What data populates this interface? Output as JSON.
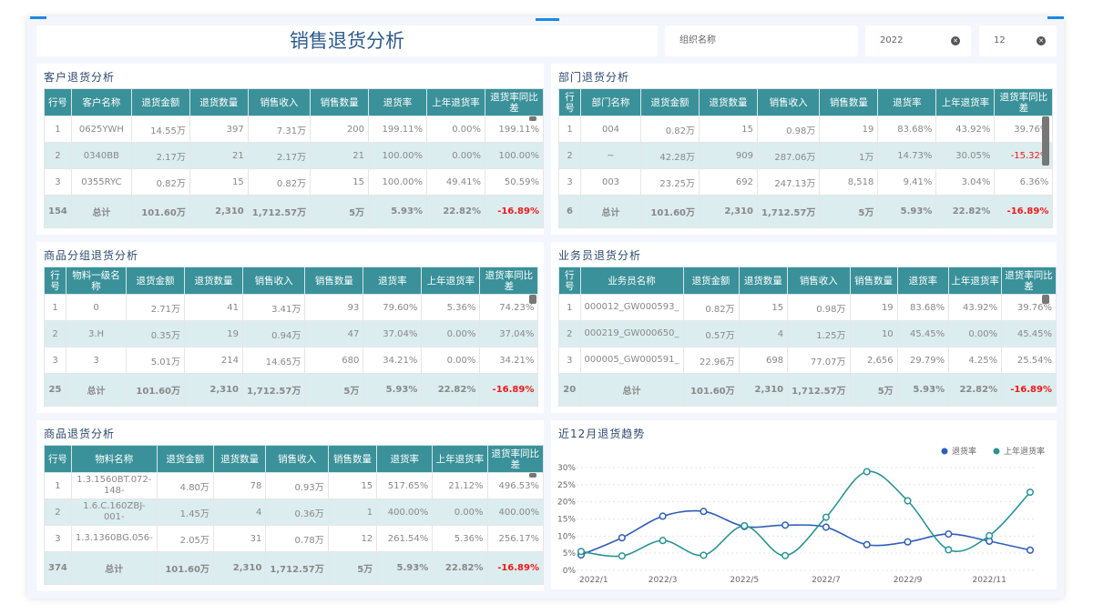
{
  "header": {
    "title": "销售退货分析",
    "org_placeholder": "组织名称",
    "year": "2022",
    "month": "12",
    "clear_icon": "x-circle-icon"
  },
  "columns_common": [
    "退货金额",
    "退货数量",
    "销售收入",
    "销售数量",
    "退货率",
    "上年退货率",
    "退货率同比差"
  ],
  "tables": [
    {
      "title": "客户退货分析",
      "col0": "行号",
      "col1": "客户名称",
      "rows": [
        [
          "1",
          "0625YWH",
          "14.55万",
          "397",
          "7.31万",
          "200",
          "199.11%",
          "0.00%",
          "199.11%"
        ],
        [
          "2",
          "0340BB",
          "2.17万",
          "21",
          "2.17万",
          "21",
          "100.00%",
          "0.00%",
          "100.00%"
        ],
        [
          "3",
          "0355RYC",
          "0.82万",
          "15",
          "0.82万",
          "15",
          "100.00%",
          "49.41%",
          "50.59%"
        ]
      ],
      "total": [
        "154",
        "总计",
        "101.60万",
        "2,310",
        "1,712.57万",
        "5万",
        "5.93%",
        "22.82%",
        "-16.89%"
      ]
    },
    {
      "title": "部门退货分析",
      "col0": "行号",
      "col1": "部门名称",
      "rows": [
        [
          "1",
          "004",
          "0.82万",
          "15",
          "0.98万",
          "19",
          "83.68%",
          "43.92%",
          "39.76%"
        ],
        [
          "2",
          "~",
          "42.28万",
          "909",
          "287.06万",
          "1万",
          "14.73%",
          "30.05%",
          "-15.32%"
        ],
        [
          "3",
          "003",
          "23.25万",
          "692",
          "247.13万",
          "8,518",
          "9.41%",
          "3.04%",
          "6.36%"
        ]
      ],
      "total": [
        "6",
        "总计",
        "101.60万",
        "2,310",
        "1,712.57万",
        "5万",
        "5.93%",
        "22.82%",
        "-16.89%"
      ]
    },
    {
      "title": "商品分组退货分析",
      "col0": "行号",
      "col1": "物料一级名称",
      "rows": [
        [
          "1",
          "0",
          "2.71万",
          "41",
          "3.41万",
          "93",
          "79.60%",
          "5.36%",
          "74.23%"
        ],
        [
          "2",
          "3.H",
          "0.35万",
          "19",
          "0.94万",
          "47",
          "37.04%",
          "0.00%",
          "37.04%"
        ],
        [
          "3",
          "3",
          "5.01万",
          "214",
          "14.65万",
          "680",
          "34.21%",
          "0.00%",
          "34.21%"
        ]
      ],
      "total": [
        "25",
        "总计",
        "101.60万",
        "2,310",
        "1,712.57万",
        "5万",
        "5.93%",
        "22.82%",
        "-16.89%"
      ]
    },
    {
      "title": "业务员退货分析",
      "col0": "行号",
      "col1": "业务员名称",
      "rows": [
        [
          "1",
          "000012_GW000593_",
          "0.82万",
          "15",
          "0.98万",
          "19",
          "83.68%",
          "43.92%",
          "39.76%"
        ],
        [
          "2",
          "000219_GW000650_",
          "0.57万",
          "4",
          "1.25万",
          "10",
          "45.45%",
          "0.00%",
          "45.45%"
        ],
        [
          "3",
          "000005_GW000591_",
          "22.96万",
          "698",
          "77.07万",
          "2,656",
          "29.79%",
          "4.25%",
          "25.54%"
        ]
      ],
      "total": [
        "20",
        "总计",
        "101.60万",
        "2,310",
        "1,712.57万",
        "5万",
        "5.93%",
        "22.82%",
        "-16.89%"
      ]
    },
    {
      "title": "商品退货分析",
      "col0": "行号",
      "col1": "物料名称",
      "rows": [
        [
          "1",
          "1.3.1560BT.072-148-",
          "4.80万",
          "78",
          "0.93万",
          "15",
          "517.65%",
          "21.12%",
          "496.53%"
        ],
        [
          "2",
          "1.6.C.160ZBJ-001-",
          "1.45万",
          "4",
          "0.36万",
          "1",
          "400.00%",
          "0.00%",
          "400.00%"
        ],
        [
          "3",
          "1.3.1360BG.056-",
          "2.05万",
          "31",
          "0.78万",
          "12",
          "261.54%",
          "5.36%",
          "256.17%"
        ]
      ],
      "total": [
        "374",
        "总计",
        "101.60万",
        "2,310",
        "1,712.57万",
        "5万",
        "5.93%",
        "22.82%",
        "-16.89%"
      ]
    }
  ],
  "chart_data": {
    "type": "line",
    "title": "近12月退货趋势",
    "x": [
      "2022/1",
      "2022/2",
      "2022/3",
      "2022/4",
      "2022/5",
      "2022/6",
      "2022/7",
      "2022/8",
      "2022/9",
      "2022/10",
      "2022/11",
      "2022/12"
    ],
    "xticks": [
      "2022/1",
      "2022/3",
      "2022/5",
      "2022/7",
      "2022/9",
      "2022/11"
    ],
    "yticks": [
      "0%",
      "5%",
      "10%",
      "15%",
      "20%",
      "25%",
      "30%"
    ],
    "ylim": [
      0,
      30
    ],
    "series": [
      {
        "name": "退货率",
        "color": "#2f5fb8",
        "values": [
          4.5,
          9.5,
          15.8,
          17.2,
          12.8,
          13.2,
          12.6,
          7.5,
          8.3,
          10.6,
          8.5,
          5.9
        ]
      },
      {
        "name": "上年退货率",
        "color": "#2a9494",
        "values": [
          5.5,
          4.2,
          8.7,
          4.4,
          13.0,
          4.3,
          15.5,
          28.8,
          20.3,
          6.0,
          10.1,
          22.8
        ]
      }
    ],
    "legend": "top-right"
  }
}
